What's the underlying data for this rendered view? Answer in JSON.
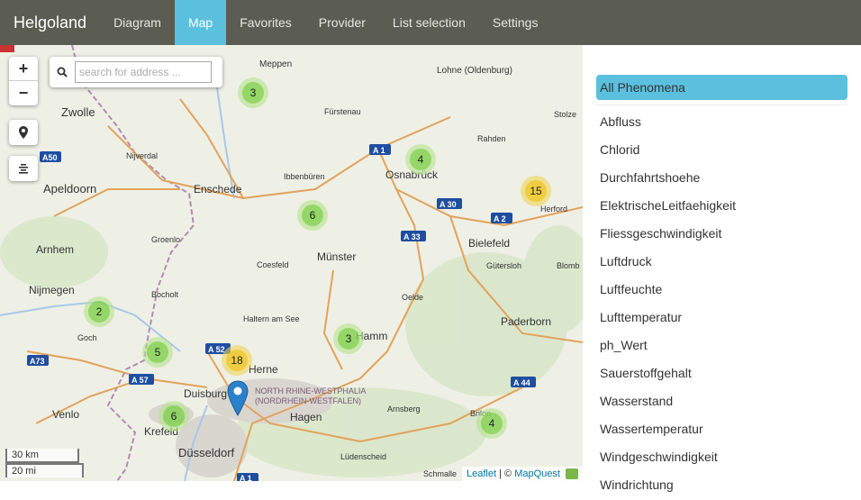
{
  "app": {
    "brand": "Helgoland"
  },
  "nav": {
    "items": [
      {
        "label": "Diagram",
        "active": false
      },
      {
        "label": "Map",
        "active": true
      },
      {
        "label": "Favorites",
        "active": false
      },
      {
        "label": "Provider",
        "active": false
      },
      {
        "label": "List selection",
        "active": false
      },
      {
        "label": "Settings",
        "active": false
      }
    ]
  },
  "map": {
    "zoom_in": "+",
    "zoom_out": "−",
    "search_placeholder": "search for address ...",
    "scale_km": "30 km",
    "scale_mi": "20 mi",
    "attribution": {
      "leaflet": "Leaflet",
      "separator": " | © ",
      "mapquest": "MapQuest"
    },
    "clusters": [
      {
        "count": "3",
        "color": "green"
      },
      {
        "count": "4",
        "color": "green"
      },
      {
        "count": "15",
        "color": "yellow"
      },
      {
        "count": "6",
        "color": "green"
      },
      {
        "count": "2",
        "color": "green"
      },
      {
        "count": "5",
        "color": "green"
      },
      {
        "count": "3",
        "color": "green"
      },
      {
        "count": "18",
        "color": "yellow"
      },
      {
        "count": "6",
        "color": "green"
      },
      {
        "count": "4",
        "color": "green"
      }
    ],
    "places": [
      "Meppen",
      "Lohne (Oldenburg)",
      "Zwolle",
      "Fürstenau",
      "Rahden",
      "Stolze",
      "Nijverdal",
      "Osnabrück",
      "Apeldoorn",
      "Enschede",
      "Ibbenbüren",
      "Herford",
      "Groenlo",
      "Münster",
      "Bielefeld",
      "Arnhem",
      "Coesfeld",
      "Gütersloh",
      "Blomb",
      "Nijmegen",
      "Bocholt",
      "Oelde",
      "Paderborn",
      "Haltern am See",
      "Hamm",
      "Goch",
      "Herne",
      "Duisburg",
      "Hagen",
      "Arnsberg",
      "Brilon",
      "Venlo",
      "Krefeld",
      "Düsseldorf",
      "Lüdenscheid",
      "Schmalle",
      "NORTH RHINE-WESTPHALIA",
      "(NORDRHEIN-WESTFALEN)"
    ],
    "roads": [
      "A50",
      "A 1",
      "A 30",
      "A 2",
      "A 33",
      "A 52",
      "A73",
      "A 57",
      "A 44",
      "A 1"
    ]
  },
  "phenomena": {
    "all_label": "All Phenomena",
    "items": [
      "Abfluss",
      "Chlorid",
      "Durchfahrtshoehe",
      "ElektrischeLeitfaehigkeit",
      "Fliessgeschwindigkeit",
      "Luftdruck",
      "Luftfeuchte",
      "Lufttemperatur",
      "ph_Wert",
      "Sauerstoffgehalt",
      "Wasserstand",
      "Wassertemperatur",
      "Windgeschwindigkeit",
      "Windrichtung"
    ]
  },
  "colors": {
    "navbar": "#5c5d52",
    "accent": "#5bc0de",
    "marker": "#2a81cb"
  }
}
